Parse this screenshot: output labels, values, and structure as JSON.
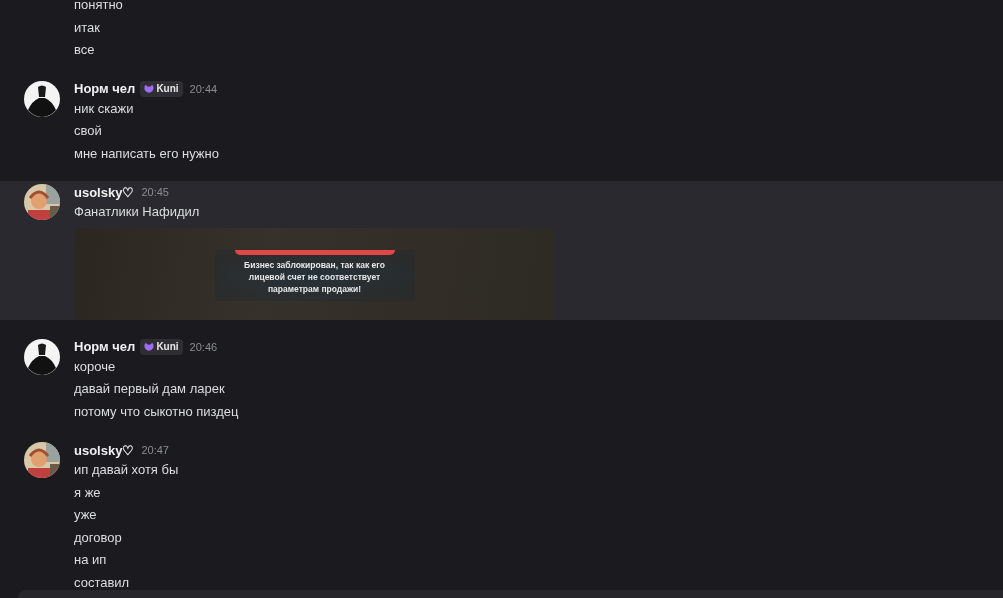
{
  "groups": [
    {
      "lines": [
        "понятно",
        "итак",
        "все"
      ],
      "highlighted": false
    },
    {
      "author": "Норм чел",
      "kind": "silhouette",
      "badge": "Kuni",
      "time": "20:44",
      "lines": [
        "ник скажи",
        "свой",
        "мне написать его нужно"
      ],
      "highlighted": false
    },
    {
      "author": "usolsky♡",
      "time": "20:45",
      "lines": [
        "Фанатлики Нафидил"
      ],
      "highlighted": true,
      "attachment": {
        "kind": "screenshot",
        "text": "Бизнес заблокирован, так как его лицевой счет не соответствует параметрам продажи!"
      }
    },
    {
      "author": "Норм чел",
      "kind": "silhouette",
      "badge": "Kuni",
      "time": "20:46",
      "lines": [
        "короче",
        "давай первый дам ларек",
        "потому что сыкотно пиздец"
      ],
      "highlighted": false
    },
    {
      "author": "usolsky♡",
      "time": "20:47",
      "lines": [
        "ип давай хотя бы",
        "я же",
        "уже",
        "договор",
        "на ип",
        "составил"
      ],
      "highlighted": false
    }
  ]
}
